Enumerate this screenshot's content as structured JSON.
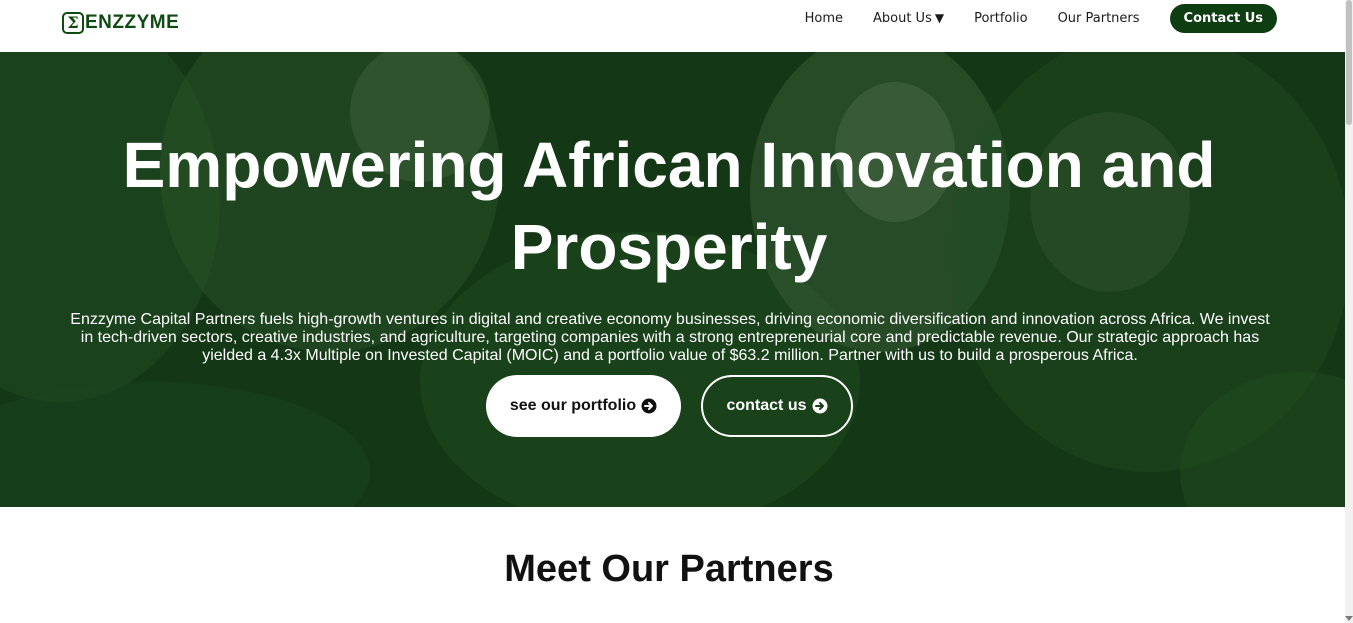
{
  "header": {
    "logo_mark": "Σ",
    "logo_text": "ENZZYME",
    "nav": {
      "home": "Home",
      "about": "About Us",
      "about_caret": "▼",
      "portfolio": "Portfolio",
      "partners": "Our Partners",
      "contact": "Contact Us"
    }
  },
  "hero": {
    "title": "Empowering African Innovation and Prosperity",
    "description": "Enzzyme Capital Partners fuels high-growth ventures in digital and creative economy businesses, driving economic diversification and innovation across Africa. We invest in tech-driven sectors, creative industries, and agriculture, targeting companies with a strong entrepreneurial core and predictable revenue. Our strategic approach has yielded a 4.3x Multiple on Invested Capital (MOIC) and a portfolio value of $63.2 million. Partner with us to build a prosperous Africa.",
    "buttons": {
      "portfolio": "see our portfolio",
      "contact": "contact us"
    }
  },
  "partners": {
    "title": "Meet Our Partners"
  },
  "icons": {
    "logo": "sigma-logo-icon",
    "caret": "caret-down-icon",
    "arrow": "arrow-circle-right-icon"
  },
  "colors": {
    "brand_green": "#0f4a12",
    "hero_overlay": "#173d19",
    "button_dark": "#0f3d12"
  }
}
